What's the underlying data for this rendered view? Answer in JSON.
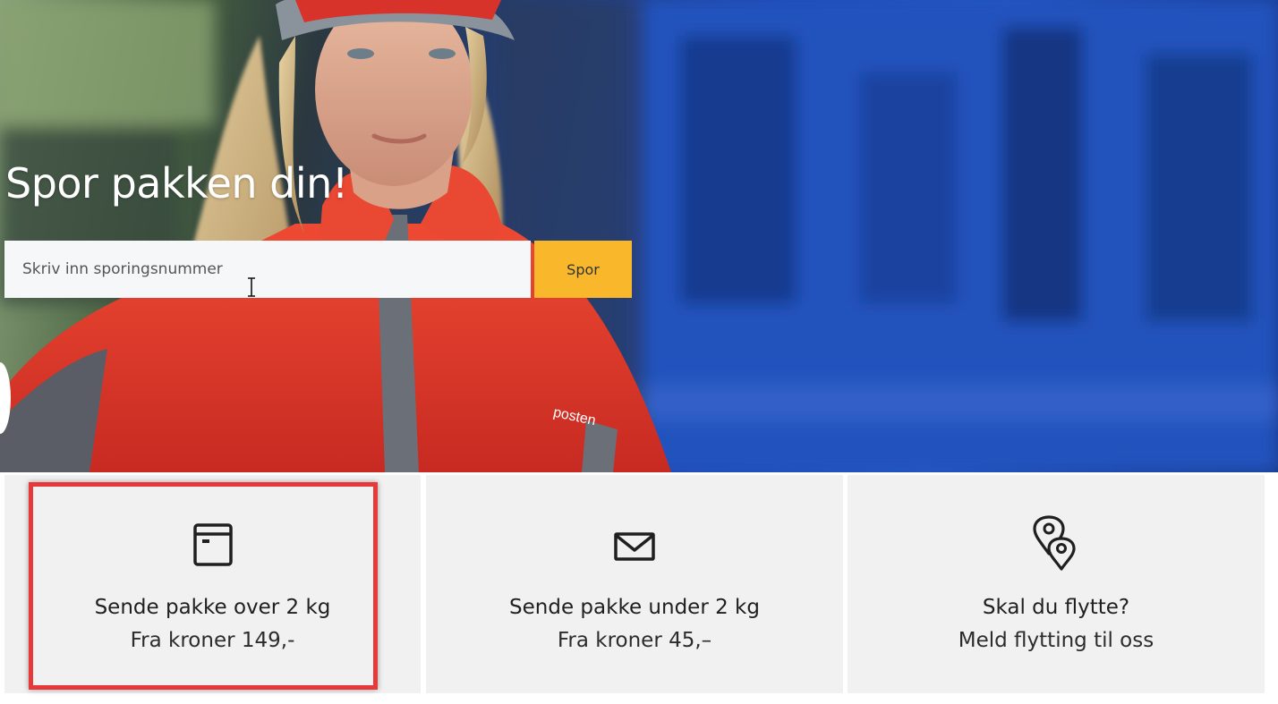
{
  "hero": {
    "title": "Spor pakken din!",
    "search": {
      "placeholder": "Skriv inn sporingsnummer",
      "value": "",
      "button_label": "Spor"
    },
    "jacket_logo_text": "posten"
  },
  "cards": [
    {
      "icon": "package-box-icon",
      "title": "Sende pakke over 2 kg",
      "subtitle": "Fra kroner 149,-"
    },
    {
      "icon": "envelope-icon",
      "title": "Sende pakke under 2 kg",
      "subtitle": "Fra kroner 45,–"
    },
    {
      "icon": "location-pins-icon",
      "title": "Skal du flytte?",
      "subtitle": "Meld flytting til oss"
    }
  ],
  "colors": {
    "accent_button": "#f9b82b",
    "card_background": "#f1f1f1",
    "highlight_border": "#e8393a",
    "hero_blue": "#1f4ab8",
    "jacket_red": "#e5412f"
  }
}
